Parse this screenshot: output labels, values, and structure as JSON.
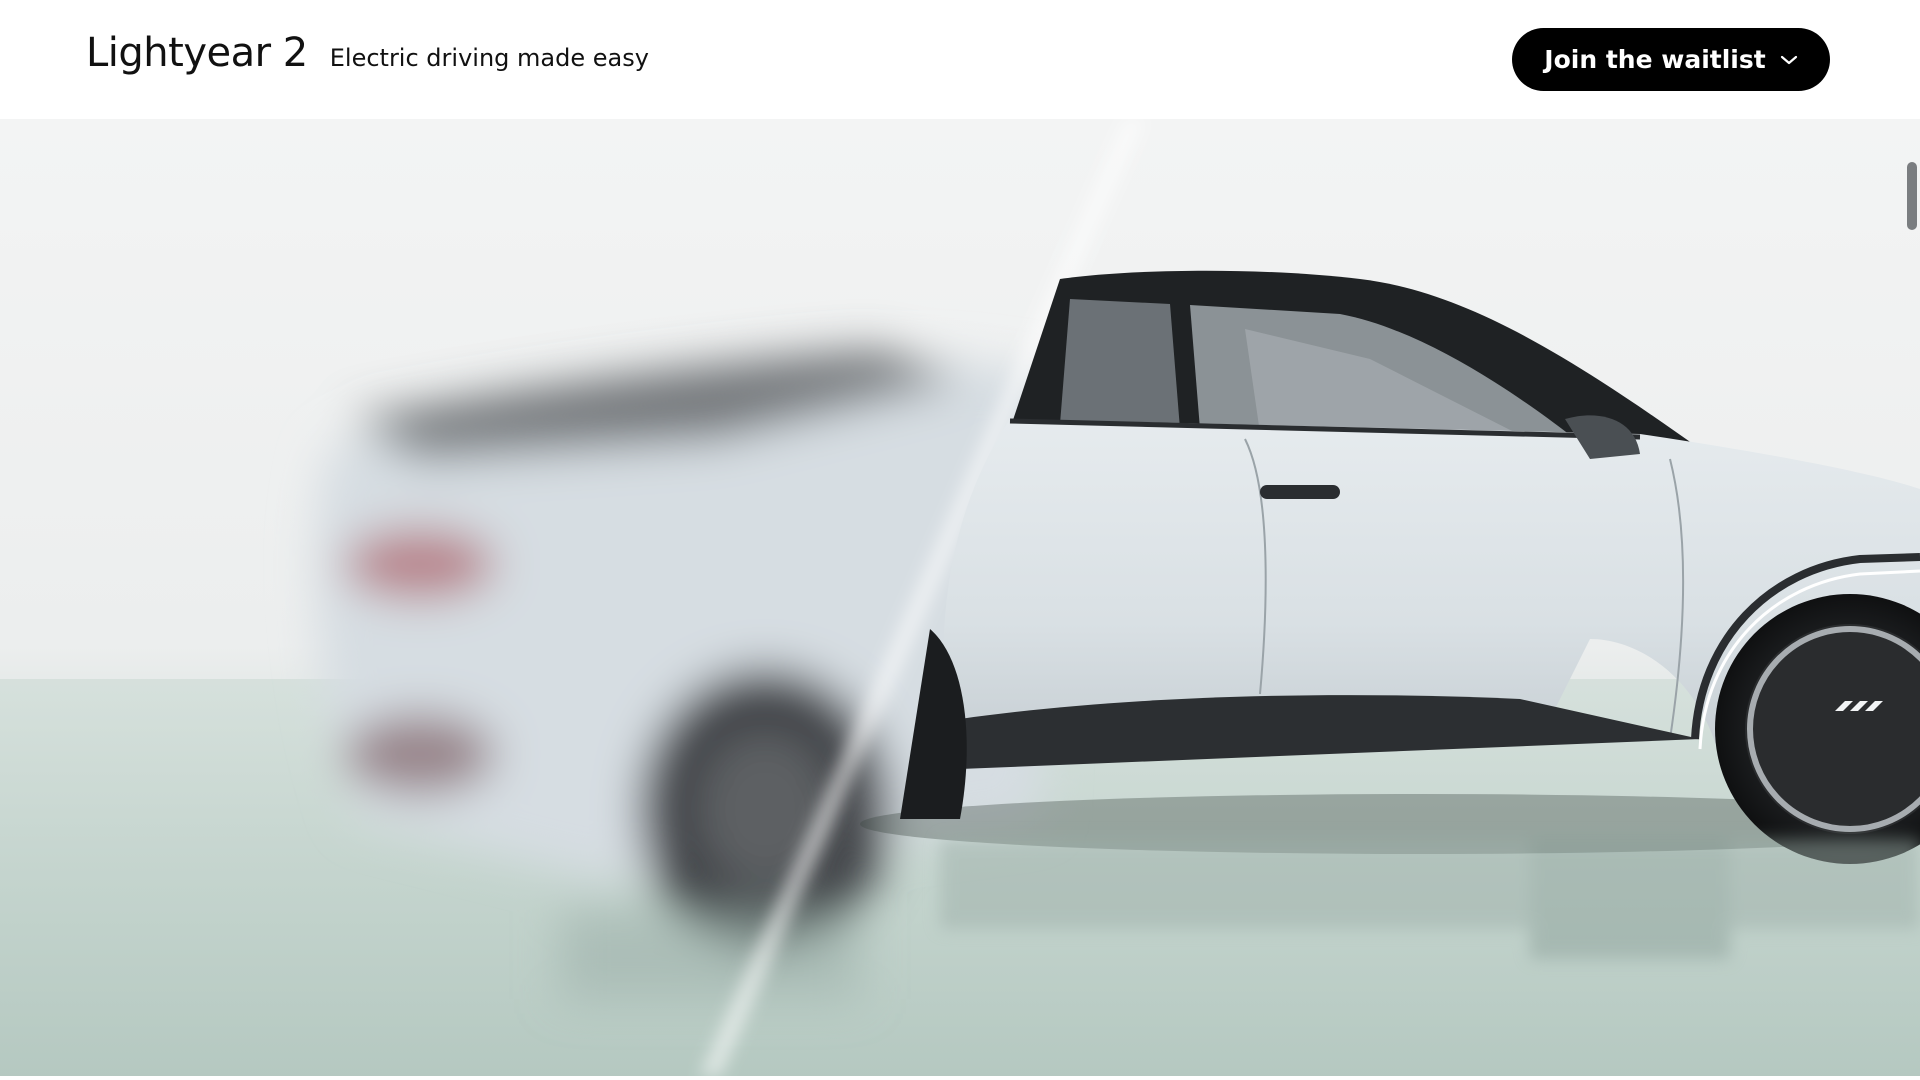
{
  "header": {
    "brand_name": "Lightyear 2",
    "tagline": "Electric driving made easy",
    "cta_label": "Join the waitlist",
    "cta_icon": "chevron-down-icon"
  },
  "hero": {
    "image_subject": "car-side-view",
    "car_color": "#dde3e6",
    "floor_color": "#b9cbc4"
  },
  "colors": {
    "accent": "#000000",
    "background": "#ffffff"
  }
}
